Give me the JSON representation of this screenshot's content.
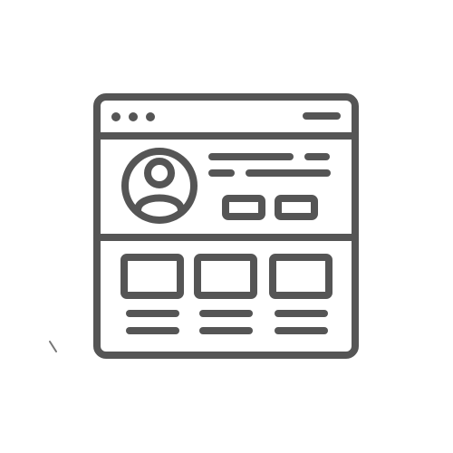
{
  "icon": {
    "name": "profile-webpage-icon",
    "stroke_color": "#555555",
    "background_color": "#ffffff"
  },
  "window": {
    "title_bar_dots": [
      "dot",
      "dot",
      "dot"
    ],
    "title_bar_menu": "hamburger-line"
  },
  "profile_section": {
    "avatar": "user-avatar-icon",
    "text_lines": 2,
    "buttons": 2
  },
  "grid_section": {
    "cards": [
      {
        "name": "card-1",
        "lines": 2
      },
      {
        "name": "card-2",
        "lines": 2
      },
      {
        "name": "card-3",
        "lines": 2
      }
    ]
  }
}
